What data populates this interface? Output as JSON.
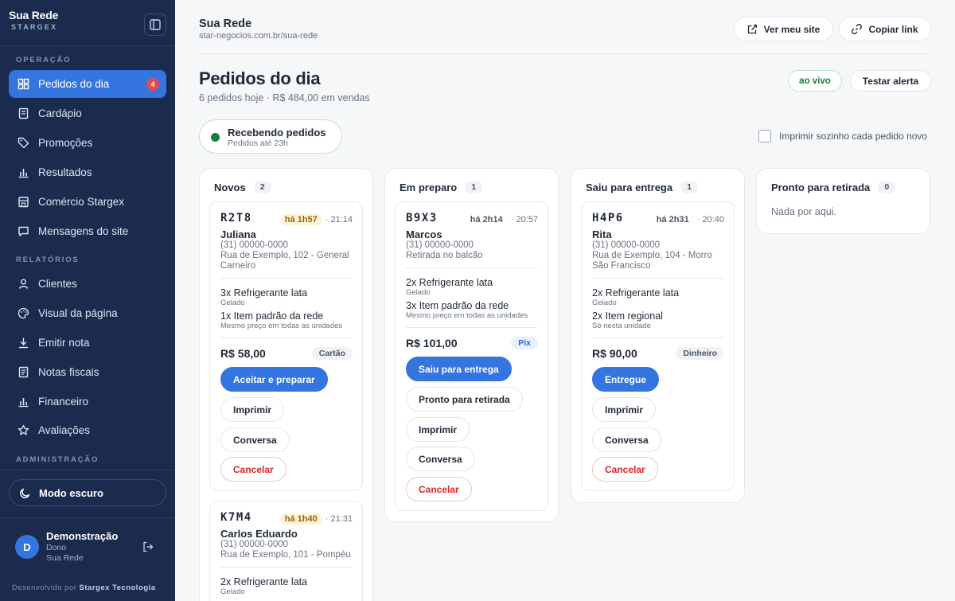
{
  "sidebar": {
    "brand": {
      "name": "Sua Rede",
      "sub": "STARGEX"
    },
    "sections": {
      "operacao": "OPERAÇÃO",
      "relatorios": "RELATÓRIOS",
      "administracao": "ADMINISTRAÇÃO"
    },
    "items": [
      {
        "label": "Pedidos do dia",
        "icon": "grid-icon",
        "badge": "4",
        "active": true
      },
      {
        "label": "Cardápio",
        "icon": "menu-book-icon"
      },
      {
        "label": "Promoções",
        "icon": "tag-icon"
      },
      {
        "label": "Resultados",
        "icon": "bar-chart-icon"
      },
      {
        "label": "Comércio Stargex",
        "icon": "store-icon"
      },
      {
        "label": "Mensagens do site",
        "icon": "message-icon"
      },
      {
        "label": "Clientes",
        "icon": "user-icon"
      },
      {
        "label": "Visual da página",
        "icon": "palette-icon"
      },
      {
        "label": "Emitir nota",
        "icon": "download-icon"
      },
      {
        "label": "Notas fiscais",
        "icon": "receipt-icon"
      },
      {
        "label": "Financeiro",
        "icon": "bar-chart-icon"
      },
      {
        "label": "Avaliações",
        "icon": "star-icon"
      }
    ],
    "dark_mode": "Modo escuro",
    "user": {
      "initial": "D",
      "name": "Demonstração",
      "role": "Dono",
      "org": "Sua Rede"
    },
    "credit_prefix": "Desenvolvido por",
    "credit_company": "Stargex Tecnologia"
  },
  "header": {
    "site_title": "Sua Rede",
    "site_url": "star-negocios.com.br/sua-rede",
    "view_site": "Ver meu site",
    "copy_link": "Copiar link"
  },
  "page": {
    "title": "Pedidos do dia",
    "subtitle": "6 pedidos hoje · R$ 484,00 em vendas",
    "live": "ao vivo",
    "test_alert": "Testar alerta",
    "receiving_title": "Recebendo pedidos",
    "receiving_sub": "Pedidos até 23h",
    "auto_print": "Imprimir sozinho cada pedido novo"
  },
  "columns": [
    {
      "title": "Novos",
      "count": "2",
      "orders": [
        {
          "code": "R2T8",
          "elapsed": "há 1h57",
          "time": "· 21:14",
          "customer": "Juliana",
          "phone": "(31) 00000-0000",
          "address": "Rua de Exemplo, 102 - General Carneiro",
          "items": [
            {
              "name": "3x Refrigerante lata",
              "note": "Gelado"
            },
            {
              "name": "1x Item padrão da rede",
              "note": "Mesmo preço em todas as unidades"
            }
          ],
          "total": "R$ 58,00",
          "payment": "Cartão",
          "actions": [
            "Aceitar e preparar",
            "Imprimir",
            "Conversa",
            "Cancelar"
          ]
        },
        {
          "code": "K7M4",
          "elapsed": "há 1h40",
          "time": "· 21:31",
          "customer": "Carlos Eduardo",
          "phone": "(31) 00000-0000",
          "address": "Rua de Exemplo, 101 - Pompéu",
          "items": [
            {
              "name": "2x Refrigerante lata",
              "note": "Gelado"
            }
          ]
        }
      ]
    },
    {
      "title": "Em preparo",
      "count": "1",
      "orders": [
        {
          "code": "B9X3",
          "elapsed": "há 2h14",
          "time": "· 20:57",
          "customer": "Marcos",
          "phone": "(31) 00000-0000",
          "address": "Retirada no balcão",
          "items": [
            {
              "name": "2x Refrigerante lata",
              "note": "Gelado"
            },
            {
              "name": "3x Item padrão da rede",
              "note": "Mesmo preço em todas as unidades"
            }
          ],
          "total": "R$ 101,00",
          "payment": "Pix",
          "actions": [
            "Saiu para entrega",
            "Pronto para retirada",
            "Imprimir",
            "Conversa",
            "Cancelar"
          ]
        }
      ]
    },
    {
      "title": "Saiu para entrega",
      "count": "1",
      "orders": [
        {
          "code": "H4P6",
          "elapsed": "há 2h31",
          "time": "· 20:40",
          "customer": "Rita",
          "phone": "(31) 00000-0000",
          "address": "Rua de Exemplo, 104 - Morro São Francisco",
          "items": [
            {
              "name": "2x Refrigerante lata",
              "note": "Gelado"
            },
            {
              "name": "2x Item regional",
              "note": "Só nesta unidade"
            }
          ],
          "total": "R$ 90,00",
          "payment": "Dinheiro",
          "actions": [
            "Entregue",
            "Imprimir",
            "Conversa",
            "Cancelar"
          ]
        }
      ]
    },
    {
      "title": "Pronto para retirada",
      "count": "0",
      "empty": "Nada por aqui."
    }
  ],
  "colors": {
    "sidebar": "#1a2b4d",
    "accent": "#3575e0",
    "success": "#15803d",
    "danger": "#dc2626",
    "warn_bg": "#fdf3d7"
  }
}
